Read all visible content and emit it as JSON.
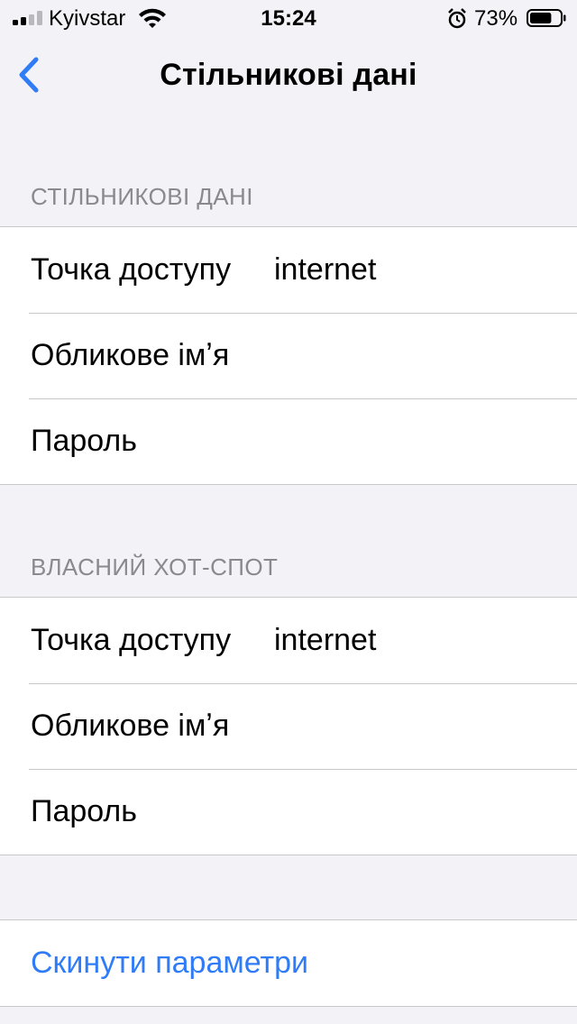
{
  "status_bar": {
    "carrier": "Kyivstar",
    "time": "15:24",
    "battery_percent": "73%",
    "signal_bars": 4,
    "signal_bars_active": 2,
    "battery_level": 0.73,
    "icons": [
      "signal-icon",
      "wifi-icon",
      "alarm-icon",
      "battery-icon"
    ]
  },
  "nav": {
    "title": "Стільникові дані",
    "back_icon": "chevron-left-icon"
  },
  "sections": {
    "cellular": {
      "header": "СТІЛЬНИКОВІ ДАНІ",
      "rows": [
        {
          "label": "Точка доступу",
          "value": "internet"
        },
        {
          "label": "Обликове імʼя",
          "value": ""
        },
        {
          "label": "Пароль",
          "value": ""
        }
      ]
    },
    "hotspot": {
      "header": "ВЛАСНИЙ ХОТ-СПОТ",
      "rows": [
        {
          "label": "Точка доступу",
          "value": "internet"
        },
        {
          "label": "Обликове імʼя",
          "value": ""
        },
        {
          "label": "Пароль",
          "value": ""
        }
      ]
    }
  },
  "reset": {
    "label": "Скинути параметри"
  },
  "colors": {
    "background": "#f2f2f7",
    "accent": "#2f7cf6",
    "header_text": "#8a8a8e",
    "separator": "#c8c7cc"
  }
}
